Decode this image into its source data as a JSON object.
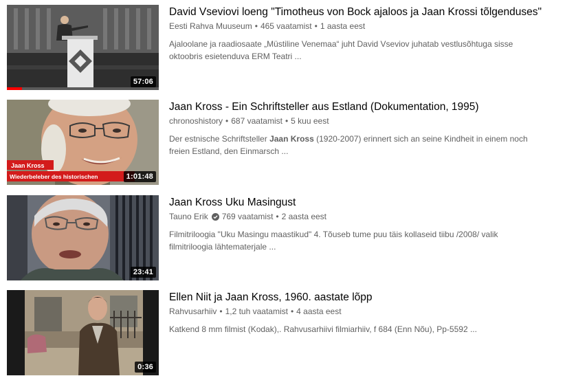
{
  "results": [
    {
      "title": "David Vseviovi loeng \"Timotheus von Bock ajaloos ja Jaan Krossi tõlgenduses\"",
      "channel": "Eesti Rahva Muuseum",
      "views": "465 vaatamist",
      "age": "1 aasta eest",
      "description": "Ajaloolane ja raadiosaate „Müstiline Venemaa“ juht David Vseviov juhatab vestlusõhtuga sisse oktoobris esietenduva ERM Teatri ...",
      "duration": "57:06",
      "watched_fraction": 0.1,
      "thumbnail_icon": "lecture-podium-thumbnail"
    },
    {
      "title": "Jaan Kross - Ein Schriftsteller aus Estland (Dokumentation, 1995)",
      "channel": "chronoshistory",
      "views": "687 vaatamist",
      "age": "5 kuu eest",
      "description_pre": "Der estnische Schriftsteller ",
      "description_bold": "Jaan Kross",
      "description_post": " (1920-2007) erinnert sich an seine Kindheit in einem noch freien Estland, den Einmarsch ...",
      "duration": "1:01:48",
      "caption_name": "Jaan Kross",
      "caption_sub": "Wiederbeleber des historischen",
      "thumbnail_icon": "portrait-thumbnail"
    },
    {
      "title": "Jaan Kross Uku Masingust",
      "channel": "Tauno Erik",
      "verified": true,
      "views": "769 vaatamist",
      "age": "2 aasta eest",
      "description": "Filmitriloogia \"Uku Masingu maastikud\" 4. Tõuseb tume puu täis kollaseid tiibu /2008/ valik filmitriloogia lähtematerjale ...",
      "duration": "23:41",
      "thumbnail_icon": "portrait-thumbnail"
    },
    {
      "title": "Ellen Niit ja Jaan Kross, 1960. aastate lõpp",
      "channel": "Rahvusarhiiv",
      "views": "1,2 tuh vaatamist",
      "age": "4 aasta eest",
      "description": "Katkend 8 mm filmist (Kodak),. Rahvusarhiivi filmiarhiiv, f 684 (Enn Nõu), Pp-5592 ...",
      "duration": "0:36",
      "thumbnail_icon": "archive-film-thumbnail"
    }
  ],
  "colors": {
    "title": "#030303",
    "meta": "#606060",
    "progress": "#ff0000",
    "duration_bg": "#000000"
  }
}
